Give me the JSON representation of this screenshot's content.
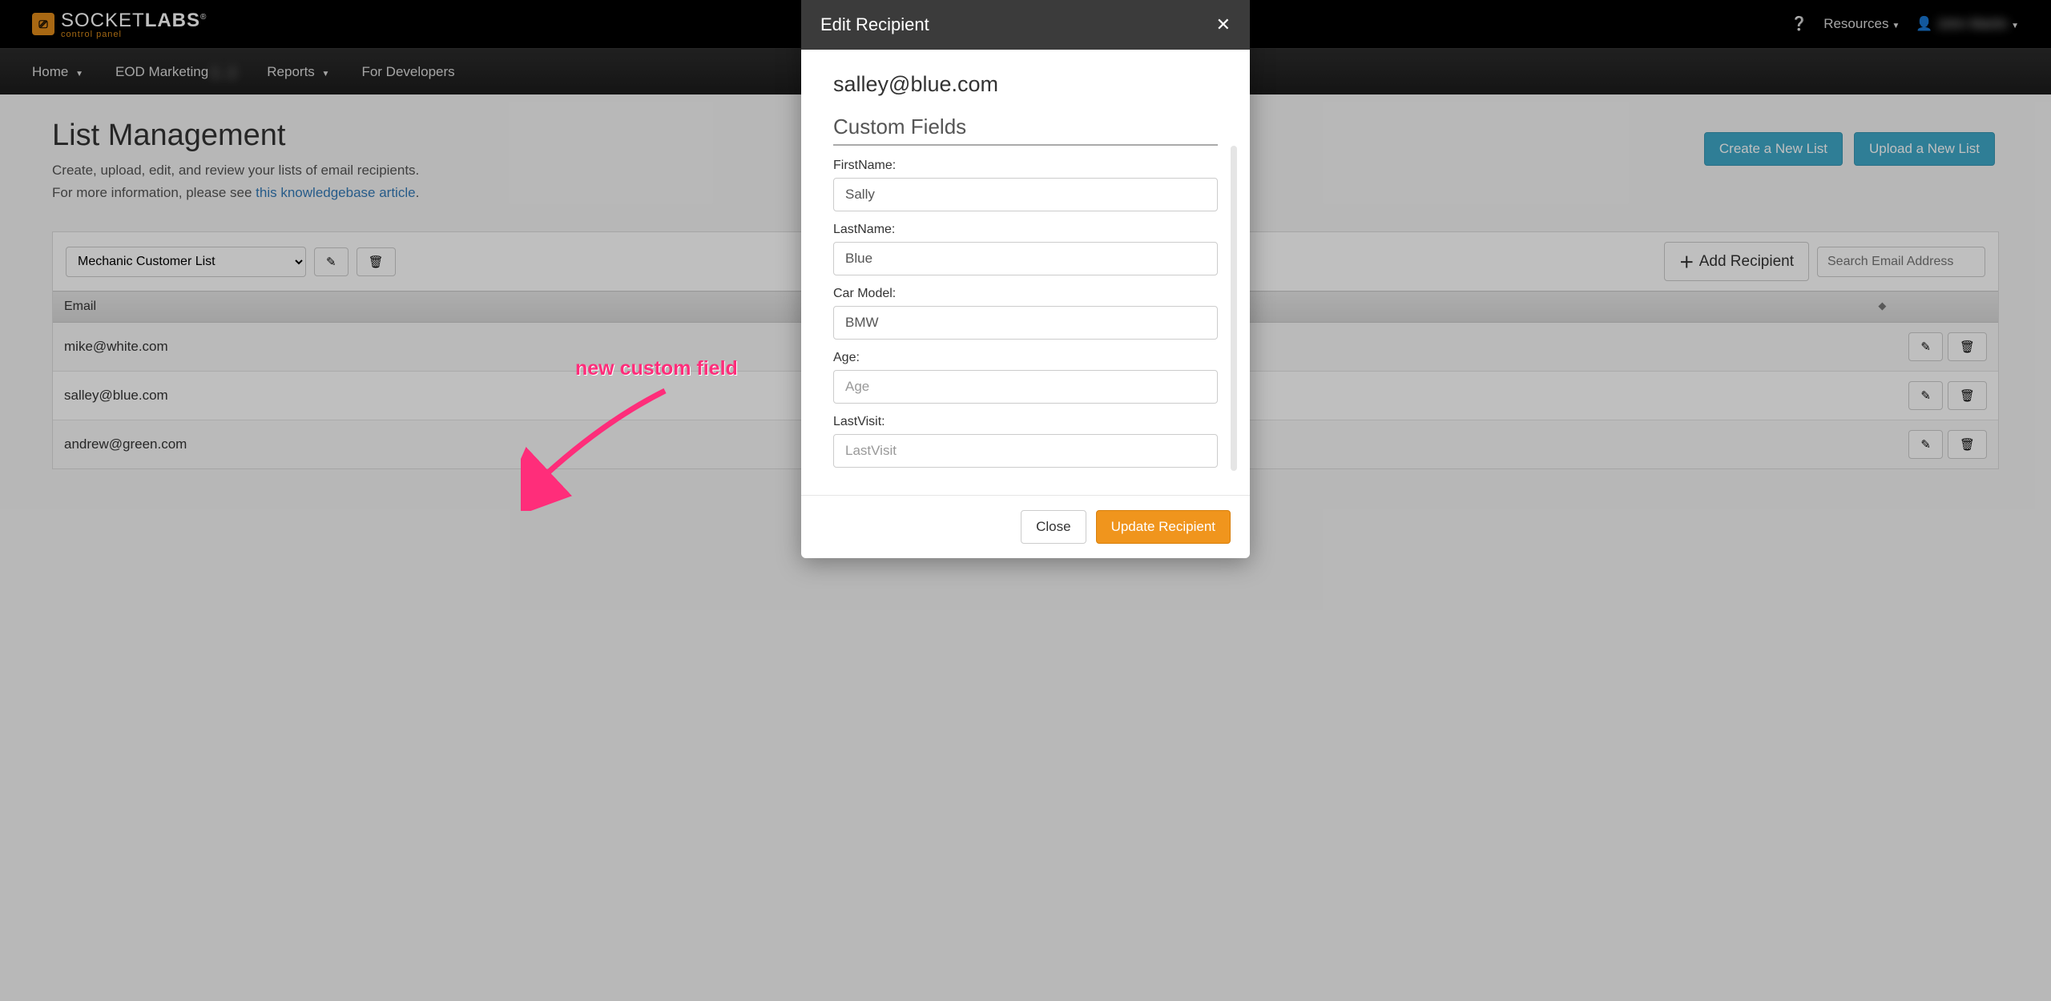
{
  "brand": {
    "name_main": "SOCKET",
    "name_bold": "LABS",
    "sub": "control panel"
  },
  "topbar": {
    "resources": "Resources",
    "username": "John Martin"
  },
  "nav": {
    "home": "Home",
    "account": "EOD Marketing",
    "account_blur": "(…)",
    "reports": "Reports",
    "fordev": "For Developers"
  },
  "page": {
    "title": "List Management",
    "desc1": "Create, upload, edit, and review your lists of email recipients.",
    "desc2_prefix": "For more information, please see ",
    "desc2_link": "this knowledgebase article",
    "btn_create": "Create a New List",
    "btn_upload": "Upload a New List"
  },
  "controls": {
    "selected_list": "Mechanic Customer List",
    "add_recipient": "Add Recipient",
    "search_placeholder": "Search Email Address"
  },
  "table": {
    "header_email": "Email",
    "rows": [
      {
        "email": "mike@white.com"
      },
      {
        "email": "salley@blue.com"
      },
      {
        "email": "andrew@green.com"
      }
    ]
  },
  "modal": {
    "title": "Edit Recipient",
    "email_heading": "salley@blue.com",
    "section": "Custom Fields",
    "fields": {
      "firstname_label": "FirstName:",
      "firstname_value": "Sally",
      "lastname_label": "LastName:",
      "lastname_value": "Blue",
      "car_label": "Car Model:",
      "car_value": "BMW",
      "age_label": "Age:",
      "age_placeholder": "Age",
      "lastvisit_label": "LastVisit:",
      "lastvisit_placeholder": "LastVisit"
    },
    "close_btn": "Close",
    "update_btn": "Update Recipient"
  },
  "annotation": {
    "label": "new custom field"
  }
}
